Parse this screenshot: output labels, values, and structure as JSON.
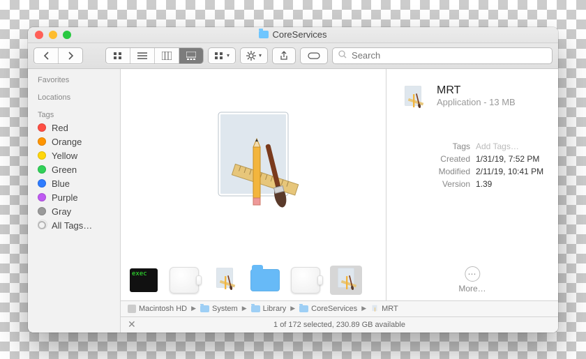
{
  "window": {
    "title": "CoreServices"
  },
  "search": {
    "placeholder": "Search"
  },
  "sidebar": {
    "sections": {
      "favorites": "Favorites",
      "locations": "Locations",
      "tags": "Tags"
    },
    "tags": [
      {
        "label": "Red",
        "color": "#ff4f44"
      },
      {
        "label": "Orange",
        "color": "#ff9500"
      },
      {
        "label": "Yellow",
        "color": "#ffd60a"
      },
      {
        "label": "Green",
        "color": "#30d158"
      },
      {
        "label": "Blue",
        "color": "#2f7cff"
      },
      {
        "label": "Purple",
        "color": "#bf5af2"
      },
      {
        "label": "Gray",
        "color": "#9a9a9a"
      }
    ],
    "all_tags_label": "All Tags…"
  },
  "thumbs": {
    "exec_label": "exec"
  },
  "info": {
    "name": "MRT",
    "subtitle": "Application - 13 MB",
    "tags_label": "Tags",
    "tags_value": "Add Tags…",
    "created_label": "Created",
    "created_value": "1/31/19, 7:52 PM",
    "modified_label": "Modified",
    "modified_value": "2/11/19, 10:41 PM",
    "version_label": "Version",
    "version_value": "1.39",
    "more_label": "More…"
  },
  "pathbar": [
    "Macintosh HD",
    "System",
    "Library",
    "CoreServices",
    "MRT"
  ],
  "status": "1 of 172 selected, 230.89 GB available"
}
